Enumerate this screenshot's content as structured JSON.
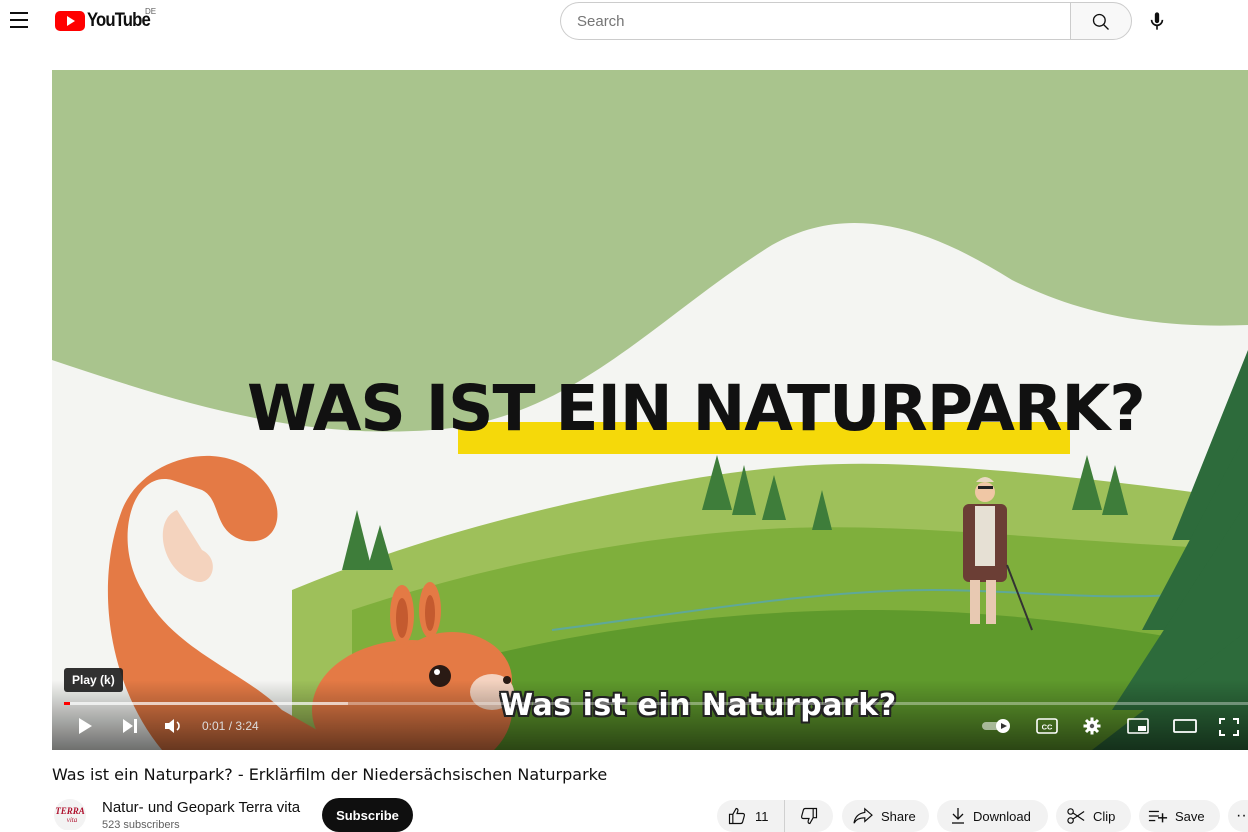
{
  "header": {
    "logo_text": "YouTube",
    "country_code": "DE",
    "search_placeholder": "Search"
  },
  "player": {
    "title_overlay": "WAS IST EIN NATURPARK?",
    "caption": "Was ist ein Naturpark?",
    "tooltip": "Play (k)",
    "time_display": "0:01 / 3:24",
    "progress_played_fraction": 0.005,
    "progress_buffered_fraction": 0.24
  },
  "video": {
    "title": "Was ist ein Naturpark? - Erklärfilm der Niedersächsischen Naturparke",
    "channel_name": "Natur- und Geopark Terra vita",
    "subscribers": "523 subscribers",
    "avatar_text": "TERRA vita"
  },
  "actions": {
    "subscribe_label": "Subscribe",
    "like_count": "11",
    "share_label": "Share",
    "download_label": "Download",
    "clip_label": "Clip",
    "save_label": "Save",
    "more_label": "···"
  },
  "colors": {
    "brand_red": "#ff0000",
    "highlight_yellow": "#f5d90a",
    "squirrel_orange": "#e47a45"
  }
}
